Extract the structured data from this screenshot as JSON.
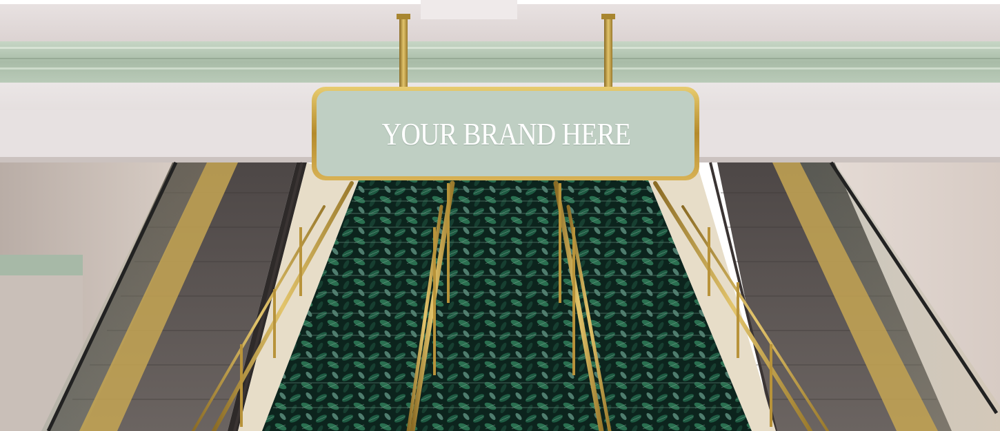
{
  "sign": {
    "text": "YOUR BRAND HERE"
  },
  "colors": {
    "sign_panel": "#bfcfc3",
    "sign_frame": "#c9a43f",
    "crown_molding": "#a8bba8",
    "ceiling": "#e6dfdc",
    "carpet": "#0f2a22",
    "brass": "#b8933a",
    "escalator_steps": "#5a5452"
  },
  "icons": {
    "carpet_pattern": "leaf-pattern",
    "rails": "brass-handrail"
  }
}
